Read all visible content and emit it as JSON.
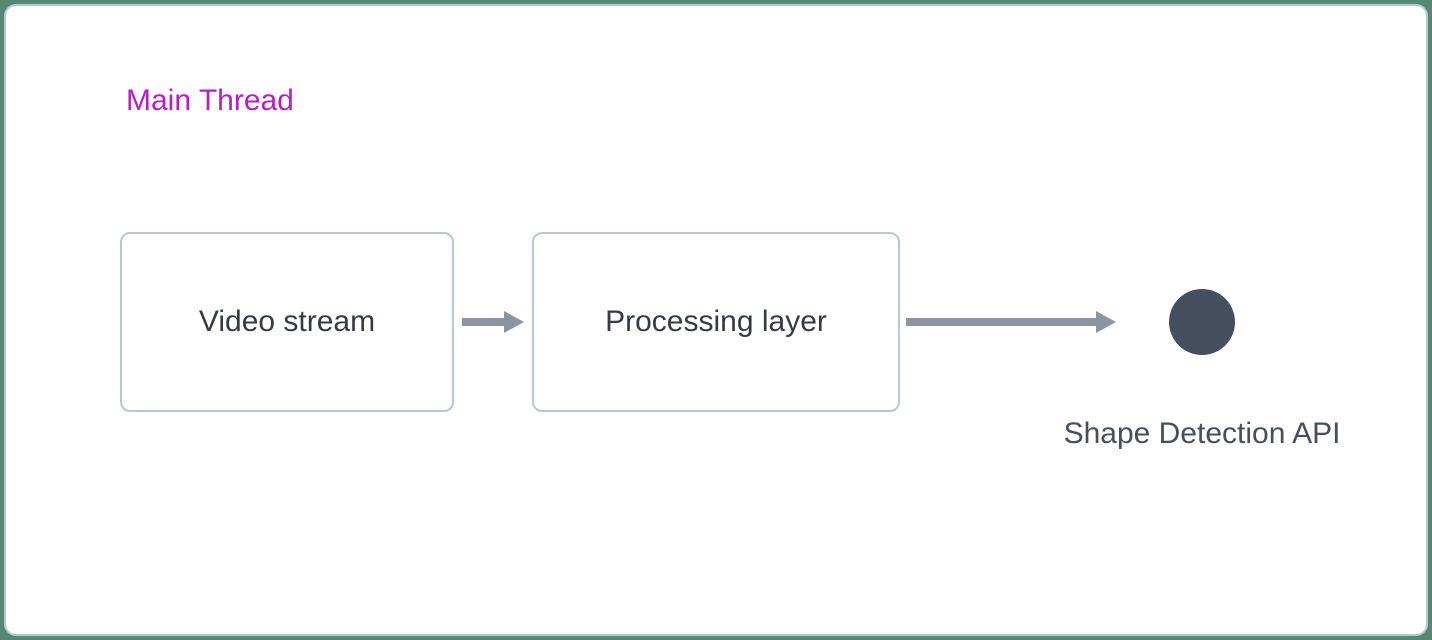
{
  "colors": {
    "accent_purple": "#b91cc7",
    "box_border": "#b4c9d6",
    "arrow": "#8a94a3",
    "dot": "#454f5f",
    "text": "#333b47",
    "frame_bg": "#ffffff",
    "page_bg": "#578874"
  },
  "diagram": {
    "thread_label": "Main Thread",
    "nodes": {
      "video": {
        "label": "Video stream"
      },
      "processing": {
        "label": "Processing layer"
      },
      "endpoint": {
        "label": "Shape Detection API"
      }
    }
  }
}
